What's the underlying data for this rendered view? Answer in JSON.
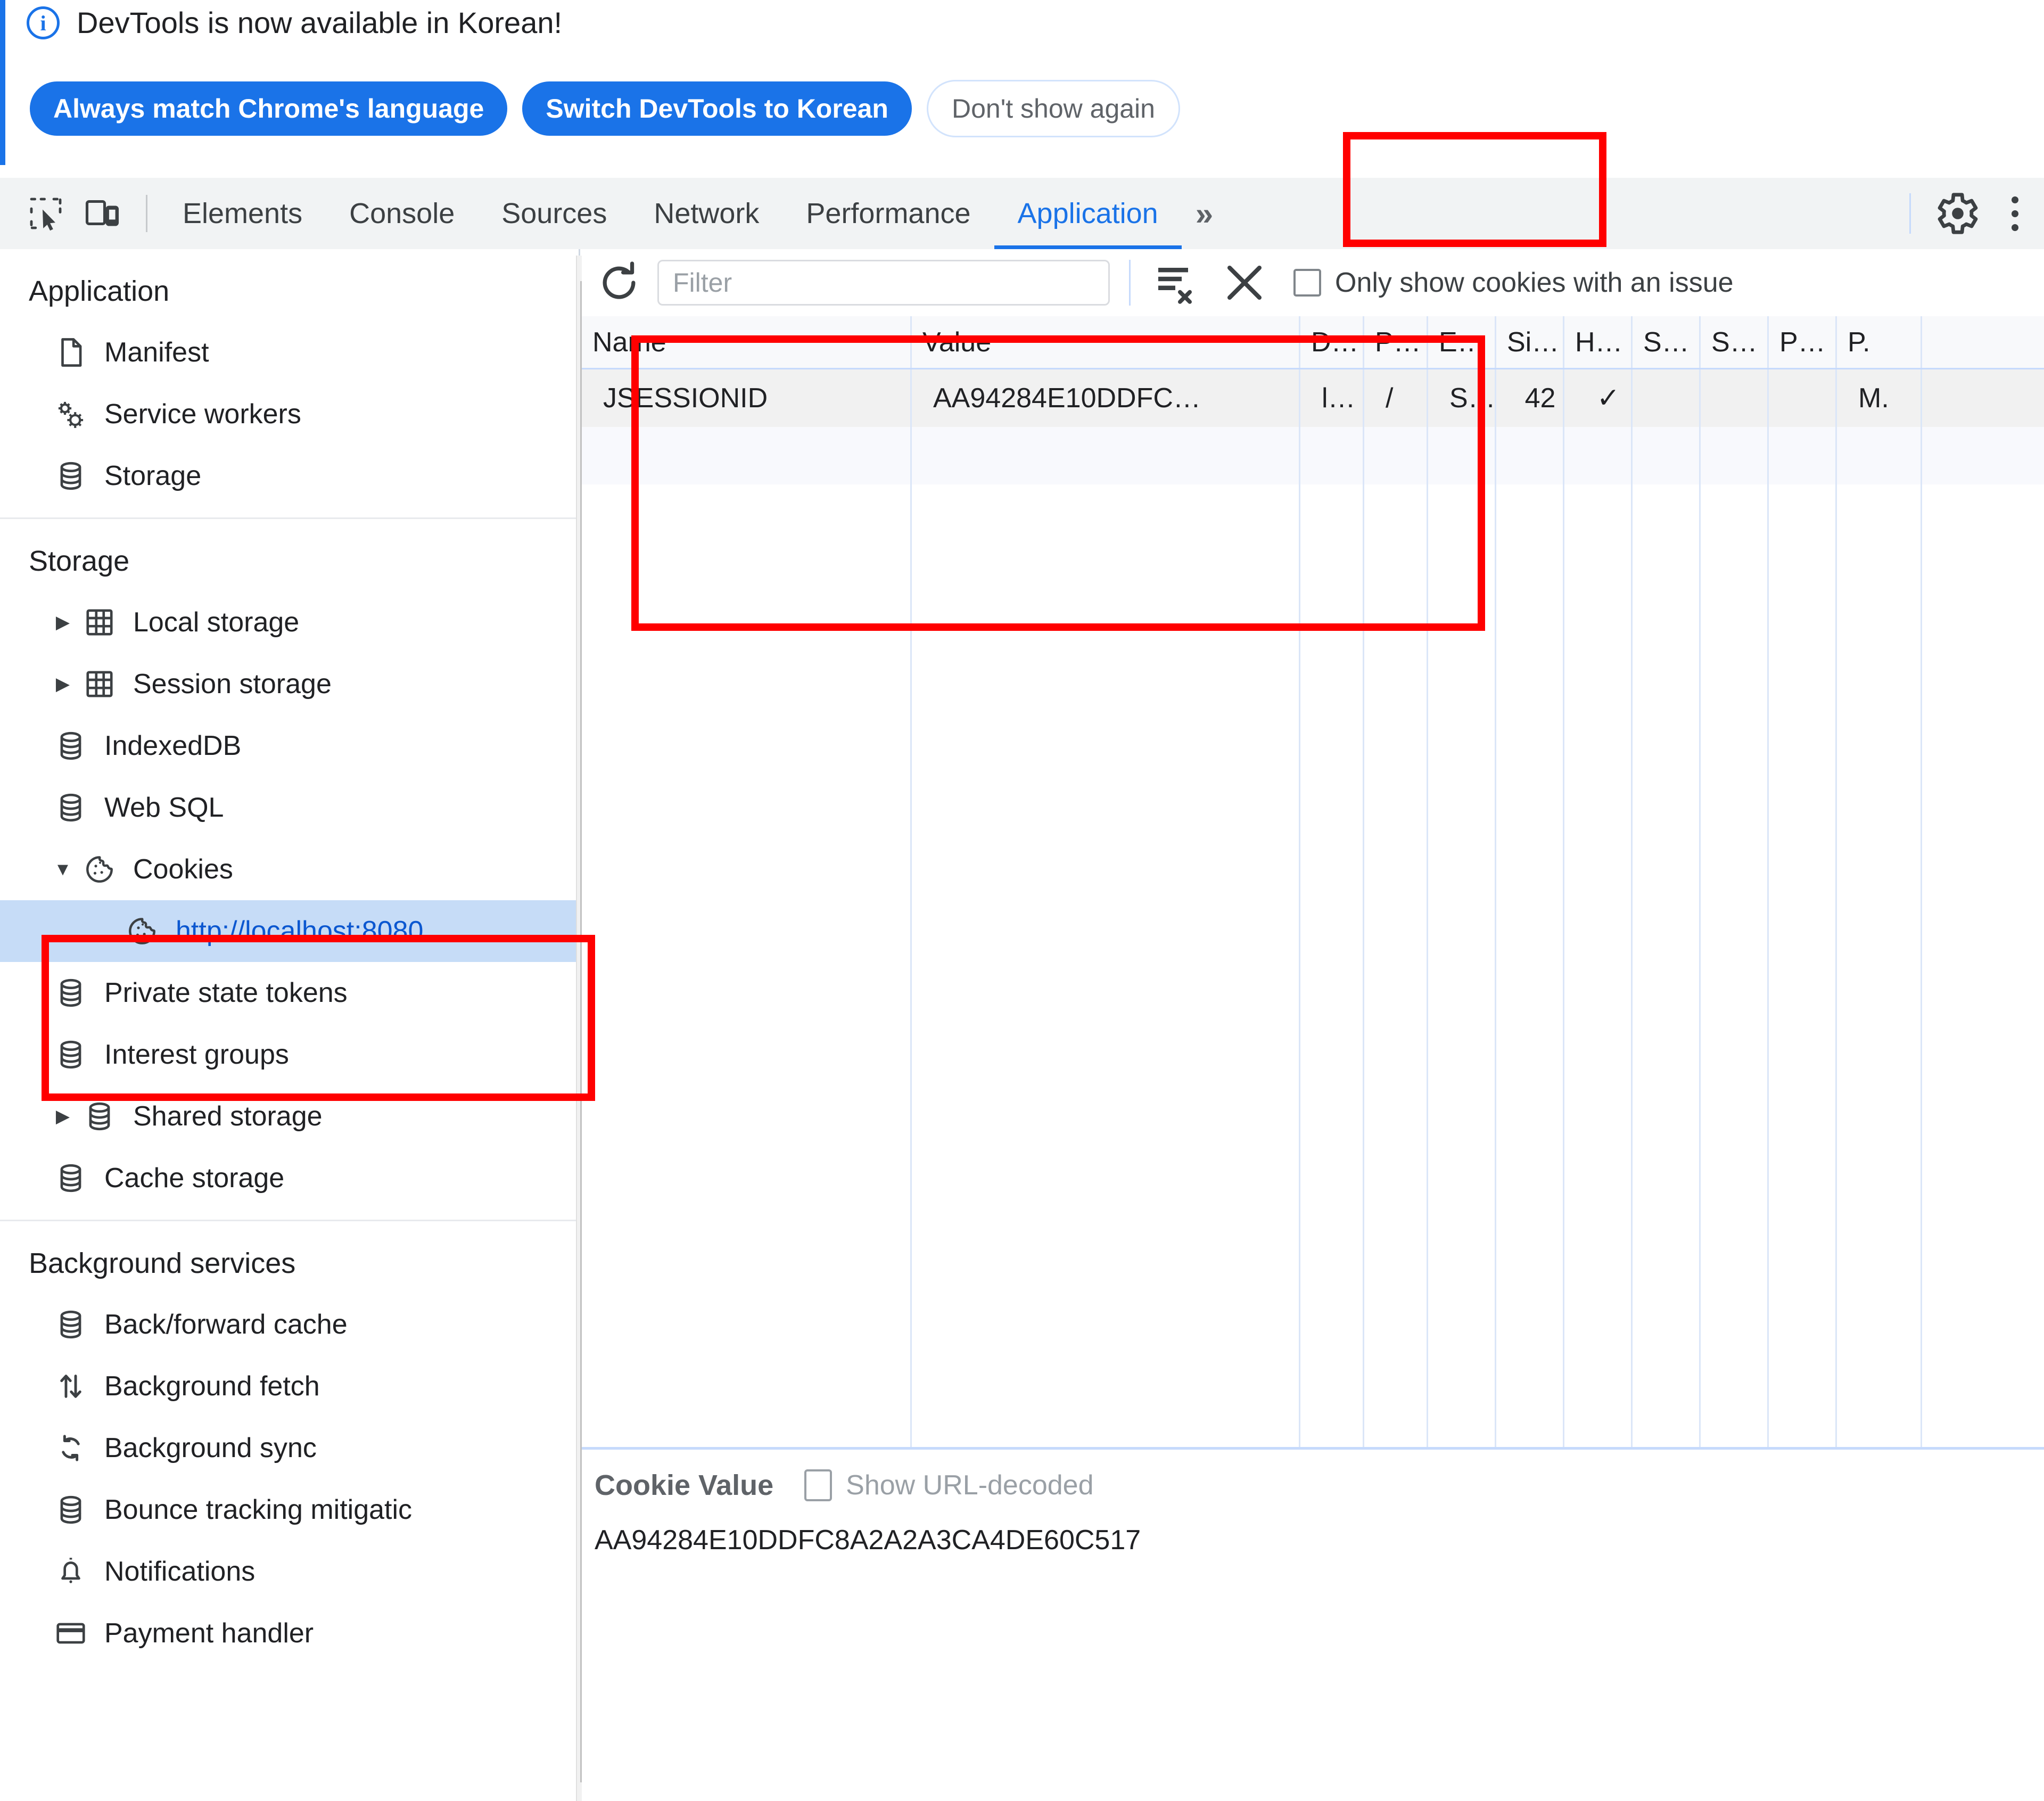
{
  "notification": {
    "message": "DevTools is now available in Korean!",
    "info_icon": "info-icon",
    "buttons": {
      "always_match": "Always match Chrome's language",
      "switch": "Switch DevTools to Korean",
      "dont_show": "Don't show again"
    }
  },
  "toolbar": {
    "inspect_icon": "inspect-element-icon",
    "device_icon": "device-toolbar-icon",
    "tabs": [
      {
        "label": "Elements",
        "active": false
      },
      {
        "label": "Console",
        "active": false
      },
      {
        "label": "Sources",
        "active": false
      },
      {
        "label": "Network",
        "active": false
      },
      {
        "label": "Performance",
        "active": false
      },
      {
        "label": "Application",
        "active": true
      }
    ],
    "more_tabs": "»",
    "settings_icon": "gear-icon",
    "menu_icon": "three-dots-icon"
  },
  "sidebar": {
    "groups": [
      {
        "title": "Application",
        "items": [
          {
            "label": "Manifest",
            "icon": "document-icon",
            "arrow": "",
            "indent": 0,
            "selected": false
          },
          {
            "label": "Service workers",
            "icon": "gears-icon",
            "arrow": "",
            "indent": 0,
            "selected": false
          },
          {
            "label": "Storage",
            "icon": "database-icon",
            "arrow": "",
            "indent": 0,
            "selected": false
          }
        ]
      },
      {
        "title": "Storage",
        "items": [
          {
            "label": "Local storage",
            "icon": "table-icon",
            "arrow": "▶",
            "indent": 0,
            "selected": false
          },
          {
            "label": "Session storage",
            "icon": "table-icon",
            "arrow": "▶",
            "indent": 0,
            "selected": false
          },
          {
            "label": "IndexedDB",
            "icon": "database-icon",
            "arrow": "",
            "indent": 0,
            "selected": false
          },
          {
            "label": "Web SQL",
            "icon": "database-icon",
            "arrow": "",
            "indent": 0,
            "selected": false
          },
          {
            "label": "Cookies",
            "icon": "cookie-icon",
            "arrow": "▼",
            "indent": 0,
            "selected": false
          },
          {
            "label": "http://localhost:8080",
            "icon": "cookie-icon",
            "arrow": "",
            "indent": 1,
            "selected": true
          },
          {
            "label": "Private state tokens",
            "icon": "database-icon",
            "arrow": "",
            "indent": 0,
            "selected": false
          },
          {
            "label": "Interest groups",
            "icon": "database-icon",
            "arrow": "",
            "indent": 0,
            "selected": false
          },
          {
            "label": "Shared storage",
            "icon": "database-icon",
            "arrow": "▶",
            "indent": 0,
            "selected": false
          },
          {
            "label": "Cache storage",
            "icon": "database-icon",
            "arrow": "",
            "indent": 0,
            "selected": false
          }
        ]
      },
      {
        "title": "Background services",
        "items": [
          {
            "label": "Back/forward cache",
            "icon": "database-icon",
            "arrow": "",
            "indent": 0,
            "selected": false
          },
          {
            "label": "Background fetch",
            "icon": "updown-arrows-icon",
            "arrow": "",
            "indent": 0,
            "selected": false
          },
          {
            "label": "Background sync",
            "icon": "sync-icon",
            "arrow": "",
            "indent": 0,
            "selected": false
          },
          {
            "label": "Bounce tracking mitigatic",
            "icon": "database-icon",
            "arrow": "",
            "indent": 0,
            "selected": false
          },
          {
            "label": "Notifications",
            "icon": "bell-icon",
            "arrow": "",
            "indent": 0,
            "selected": false
          },
          {
            "label": "Payment handler",
            "icon": "card-icon",
            "arrow": "",
            "indent": 0,
            "selected": false
          }
        ]
      }
    ]
  },
  "cookie_toolbar": {
    "refresh_icon": "refresh-icon",
    "filter_placeholder": "Filter",
    "filter_value": "",
    "clear_filtered_icon": "clear-filtered-cookies-icon",
    "clear_all_icon": "clear-all-cookies-icon",
    "only_issues_label": "Only show cookies with an issue",
    "only_issues_checked": false
  },
  "cookie_table": {
    "columns": [
      "Name",
      "Value",
      "D…",
      "P…",
      "E…",
      "Si…",
      "H…",
      "S…",
      "S…",
      "P…",
      "P."
    ],
    "rows": [
      {
        "name": "JSESSIONID",
        "value": "AA94284E10DDFC…",
        "domain": "l…",
        "path": "/",
        "expires": "S…",
        "size": "42",
        "httponly": "✓",
        "secure": "",
        "samesite": "",
        "partition": "",
        "priority": "M."
      }
    ]
  },
  "cookie_value_pane": {
    "title": "Cookie Value",
    "show_url_decoded_label": "Show URL-decoded",
    "show_url_decoded_checked": false,
    "value": "AA94284E10DDFC8A2A2A3CA4DE60C517"
  },
  "colors": {
    "accent": "#1a73e8",
    "annotation": "#ff0000",
    "selection": "#c6dcf7"
  }
}
